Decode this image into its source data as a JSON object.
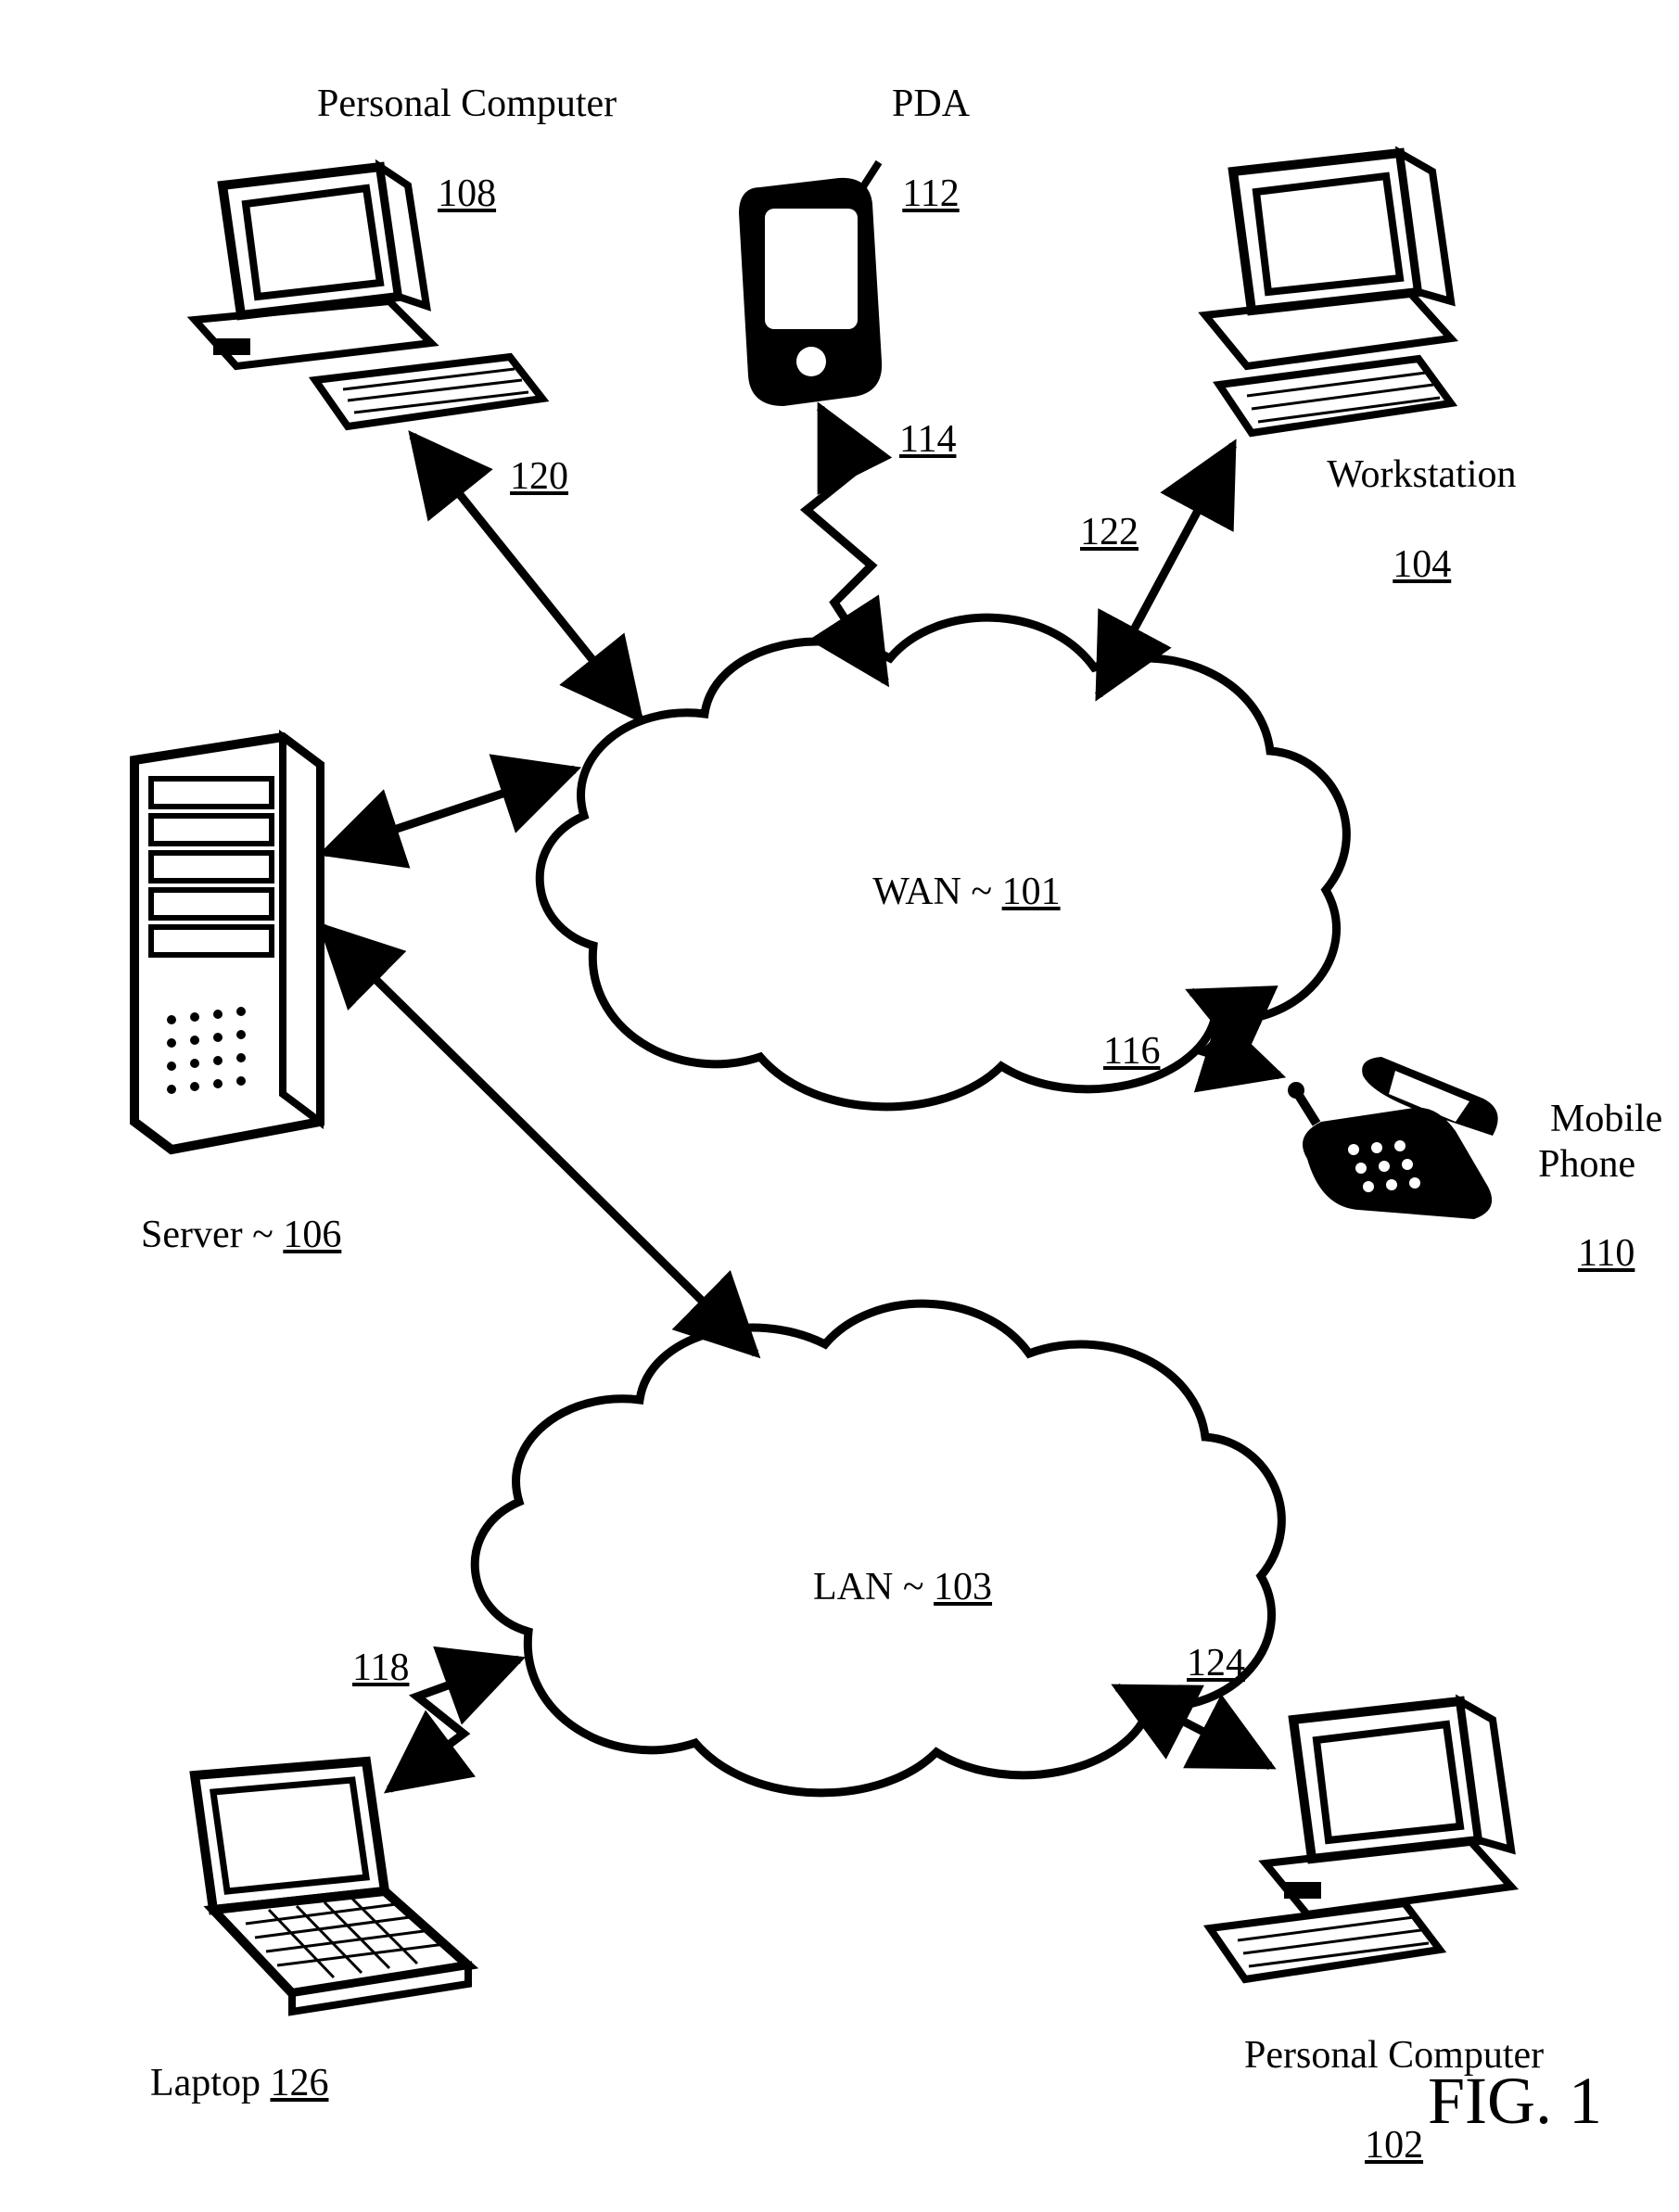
{
  "nodes": {
    "pc1": {
      "name": "Personal Computer",
      "ref": "108"
    },
    "pda": {
      "name": "PDA",
      "ref": "112"
    },
    "workstation": {
      "name": "Workstation",
      "ref": "104"
    },
    "server": {
      "name": "Server ~ ",
      "ref": "106"
    },
    "mobile": {
      "name": "Mobile\nPhone",
      "ref": "110"
    },
    "laptop": {
      "name": "Laptop ",
      "ref": "126"
    },
    "pc2": {
      "name": "Personal Computer",
      "ref": "102"
    },
    "wan": {
      "name": "WAN ~ ",
      "ref": "101"
    },
    "lan": {
      "name": "LAN ~ ",
      "ref": "103"
    }
  },
  "edges": {
    "e120": "120",
    "e114": "114",
    "e122": "122",
    "e116": "116",
    "e118": "118",
    "e124": "124"
  },
  "figure_caption": "FIG. 1"
}
